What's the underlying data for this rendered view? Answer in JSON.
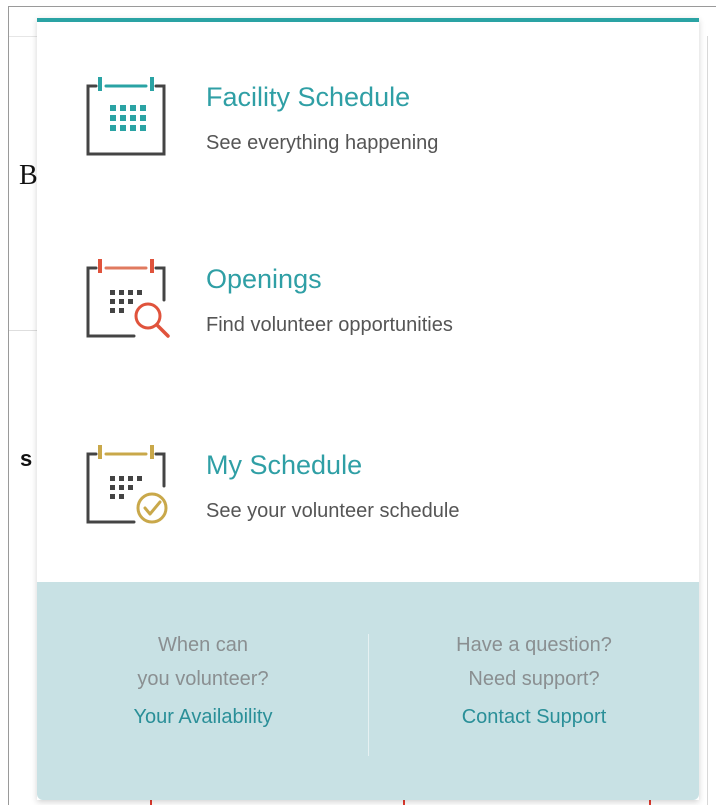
{
  "background": {
    "partial_letter_top": "B",
    "partial_letter_mid": "s"
  },
  "menu": {
    "accent_color": "#2aa3a4",
    "items": [
      {
        "icon": "calendar-grid-icon",
        "title": "Facility Schedule",
        "subtitle": "See everything happening"
      },
      {
        "icon": "calendar-search-icon",
        "title": "Openings",
        "subtitle": "Find volunteer opportunities"
      },
      {
        "icon": "calendar-check-icon",
        "title": "My Schedule",
        "subtitle": "See your volunteer schedule"
      }
    ]
  },
  "footer": {
    "availability": {
      "line1": "When can",
      "line2": "you volunteer?",
      "link": "Your Availability"
    },
    "support": {
      "line1": "Have a question?",
      "line2": "Need support?",
      "link": "Contact Support"
    }
  }
}
